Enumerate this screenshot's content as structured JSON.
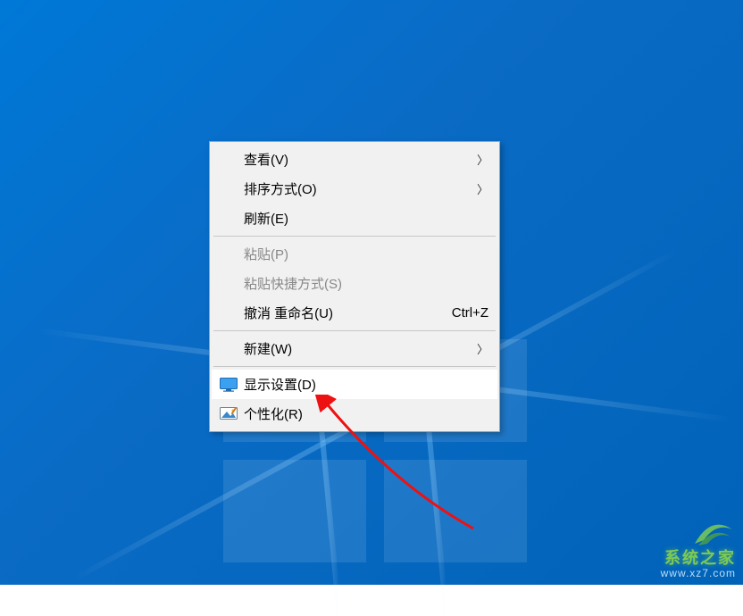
{
  "menu": {
    "items": [
      {
        "label": "查看(V)",
        "submenu": true,
        "icon": null,
        "disabled": false
      },
      {
        "label": "排序方式(O)",
        "submenu": true,
        "icon": null,
        "disabled": false
      },
      {
        "label": "刷新(E)",
        "submenu": false,
        "icon": null,
        "disabled": false
      }
    ],
    "items2": [
      {
        "label": "粘贴(P)",
        "submenu": false,
        "icon": null,
        "disabled": true
      },
      {
        "label": "粘贴快捷方式(S)",
        "submenu": false,
        "icon": null,
        "disabled": true
      },
      {
        "label": "撤消 重命名(U)",
        "submenu": false,
        "icon": null,
        "disabled": false,
        "shortcut": "Ctrl+Z"
      }
    ],
    "items3": [
      {
        "label": "新建(W)",
        "submenu": true,
        "icon": null,
        "disabled": false
      }
    ],
    "items4": [
      {
        "label": "显示设置(D)",
        "submenu": false,
        "icon": "monitor",
        "disabled": false,
        "hovered": true
      },
      {
        "label": "个性化(R)",
        "submenu": false,
        "icon": "personalize",
        "disabled": false
      }
    ]
  },
  "watermark": {
    "line1": "系统之家",
    "line2": "www.xz7.com"
  }
}
